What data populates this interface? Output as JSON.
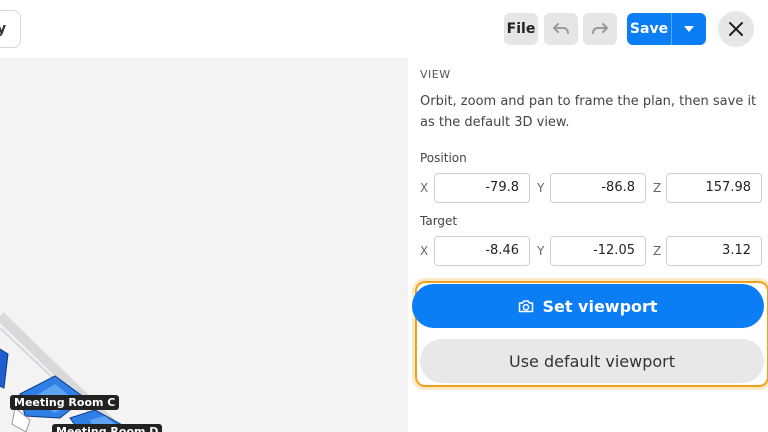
{
  "toolbar": {
    "view_tab_label": "y",
    "file_label": "File",
    "undo_icon": "undo-icon",
    "redo_icon": "redo-icon",
    "save_label": "Save",
    "save_menu_icon": "caret-down-icon",
    "close_icon": "close-icon"
  },
  "viewport": {
    "rooms": [
      {
        "label": "Meeting Room C"
      },
      {
        "label": "Meeting Room D"
      }
    ]
  },
  "panel": {
    "section_title": "VIEW",
    "description": "Orbit, zoom and pan to frame the plan, then save it as the default 3D view.",
    "position": {
      "label": "Position",
      "x_label": "X",
      "y_label": "Y",
      "z_label": "Z",
      "x": "-79.8",
      "y": "-86.8",
      "z": "157.98"
    },
    "target": {
      "label": "Target",
      "x_label": "X",
      "y_label": "Y",
      "z_label": "Z",
      "x": "-8.46",
      "y": "-12.05",
      "z": "3.12"
    },
    "set_viewport_label": "Set viewport",
    "set_viewport_icon": "camera-icon",
    "use_default_label": "Use default viewport"
  },
  "colors": {
    "primary": "#0b7ef5",
    "highlight": "#f0a020",
    "button_gray": "#e6e6e6"
  }
}
